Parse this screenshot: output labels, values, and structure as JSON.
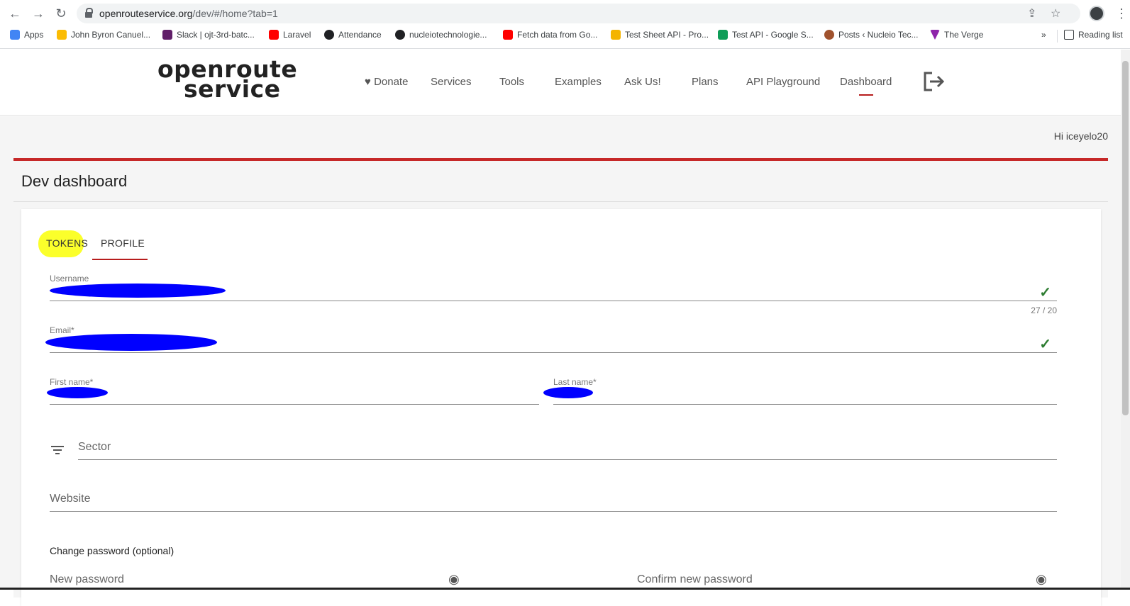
{
  "browser": {
    "url_main": "openrouteservice.org",
    "url_rest": "/dev/#/home?tab=1",
    "bookmarks": [
      {
        "label": "Apps",
        "color": "#4285f4"
      },
      {
        "label": "John Byron Canuel...",
        "color": "#fbbc04"
      },
      {
        "label": "Slack | ojt-3rd-batc...",
        "color": "#611f69"
      },
      {
        "label": "Laravel",
        "color": "#ff0000"
      },
      {
        "label": "Attendance",
        "color": "#202124"
      },
      {
        "label": "nucleiotechnologie...",
        "color": "#202124"
      },
      {
        "label": "Fetch data from Go...",
        "color": "#ff0000"
      },
      {
        "label": "Test Sheet API - Pro...",
        "color": "#f4b400"
      },
      {
        "label": "Test API - Google S...",
        "color": "#0f9d58"
      },
      {
        "label": "Posts ‹ Nucleio Tec...",
        "color": "#a0522d"
      },
      {
        "label": "The Verge",
        "color": "#8e24aa"
      }
    ],
    "more_bookmarks": "»",
    "reading_list": "Reading list"
  },
  "header": {
    "logo_line1": "openroute",
    "logo_line2": "service",
    "nav": [
      {
        "label": "♥ Donate"
      },
      {
        "label": "Services"
      },
      {
        "label": "Tools"
      },
      {
        "label": "Examples"
      },
      {
        "label": "Ask Us!"
      },
      {
        "label": "Plans"
      },
      {
        "label": "API Playground"
      },
      {
        "label": "Dashboard",
        "active": true
      }
    ]
  },
  "greeting": "Hi iceyelo20",
  "dashboard": {
    "title": "Dev dashboard",
    "tabs": {
      "tokens": "TOKENS",
      "profile": "PROFILE"
    },
    "fields": {
      "username_label": "Username",
      "username_counter": "27 / 20",
      "email_label": "Email*",
      "first_name_label": "First name*",
      "last_name_label": "Last name*",
      "sector_placeholder": "Sector",
      "website_placeholder": "Website",
      "change_password_label": "Change password (optional)",
      "new_password_placeholder": "New password",
      "confirm_password_placeholder": "Confirm new password"
    }
  },
  "colors": {
    "accent": "#c62828",
    "highlight": "#fbff2b",
    "redaction": "#0000ff",
    "valid": "#2e7d32"
  }
}
